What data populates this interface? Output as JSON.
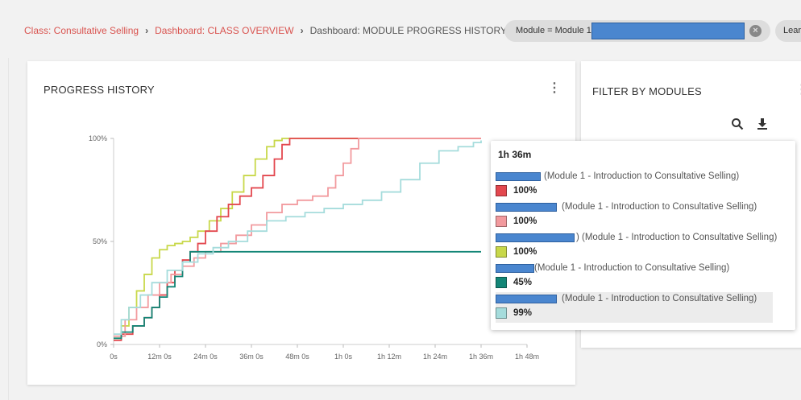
{
  "breadcrumb": {
    "items": [
      "Class: Consultative Selling",
      "Dashboard: CLASS OVERVIEW"
    ],
    "current": "Dashboard: MODULE PROGRESS HISTORY",
    "separator": "›"
  },
  "filter_pill": {
    "label": "Module = Module 1",
    "close_icon": "close-circle-icon"
  },
  "filter_pill_2": {
    "label": "Lear"
  },
  "progress_card": {
    "title": "PROGRESS HISTORY",
    "menu_icon": "kebab-menu-icon"
  },
  "filter_card": {
    "title": "FILTER BY MODULES",
    "menu_icon": "kebab-menu-icon",
    "search_icon": "search-icon",
    "download_icon": "download-icon"
  },
  "tooltip": {
    "time": "1h 36m",
    "rows": [
      {
        "name": "(Module 1 - Introduction to Consultative Selling)",
        "value": "100%",
        "color": "#e3484f"
      },
      {
        "name": "(Module 1 - Introduction to Consultative Selling)",
        "value": "100%",
        "color": "#f29a9e"
      },
      {
        "name": ") (Module 1 - Introduction to Consultative Selling)",
        "value": "100%",
        "color": "#c8d84a"
      },
      {
        "name": "(Module 1 - Introduction to Consultative Selling)",
        "value": "45%",
        "color": "#138677"
      },
      {
        "name": "(Module 1 - Introduction to Consultative Selling)",
        "value": "99%",
        "color": "#a5dcdc"
      }
    ]
  },
  "chart_data": {
    "type": "line",
    "title": "PROGRESS HISTORY",
    "x_unit": "minutes",
    "xlim": [
      0,
      108
    ],
    "ylim": [
      0,
      100
    ],
    "x_ticks": [
      0,
      12,
      24,
      36,
      48,
      60,
      72,
      84,
      96,
      108
    ],
    "x_tick_labels": [
      "0s",
      "12m 0s",
      "24m 0s",
      "36m 0s",
      "48m 0s",
      "1h 0s",
      "1h 12m",
      "1h 24m",
      "1h 36m",
      "1h 48m"
    ],
    "y_ticks": [
      0,
      50,
      100
    ],
    "y_tick_labels": [
      "0%",
      "50%",
      "100%"
    ],
    "grid": false,
    "legend": "none",
    "step": true,
    "series": [
      {
        "color": "#c8d84a",
        "x": [
          0,
          2,
          4,
          6,
          8,
          10,
          12,
          14,
          16,
          18,
          20,
          22,
          25,
          28,
          31,
          34,
          37,
          40,
          42,
          44
        ],
        "y": [
          3,
          9,
          18,
          26,
          34,
          42,
          46,
          48,
          49,
          50,
          52,
          55,
          60,
          66,
          74,
          82,
          90,
          96,
          99,
          100
        ]
      },
      {
        "color": "#e3484f",
        "x": [
          0,
          2,
          5,
          8,
          10,
          12,
          14,
          16,
          18,
          20,
          22,
          24,
          27,
          30,
          33,
          36,
          39,
          42,
          44,
          46
        ],
        "y": [
          2,
          5,
          9,
          13,
          18,
          24,
          30,
          36,
          41,
          45,
          49,
          55,
          62,
          68,
          72,
          76,
          82,
          90,
          97,
          100
        ]
      },
      {
        "color": "#f29a9e",
        "x": [
          0,
          3,
          6,
          9,
          12,
          15,
          18,
          21,
          24,
          28,
          32,
          36,
          40,
          44,
          48,
          52,
          56,
          58,
          60,
          62,
          64
        ],
        "y": [
          4,
          12,
          18,
          24,
          30,
          34,
          38,
          42,
          45,
          49,
          53,
          58,
          64,
          68,
          70,
          72,
          76,
          82,
          88,
          95,
          100
        ]
      },
      {
        "color": "#138677",
        "x": [
          0,
          2,
          5,
          8,
          10,
          12,
          14,
          16,
          18,
          20,
          96
        ],
        "y": [
          3,
          6,
          9,
          13,
          18,
          23,
          28,
          33,
          40,
          45,
          45
        ]
      },
      {
        "color": "#a5dcdc",
        "x": [
          0,
          2,
          4,
          7,
          10,
          14,
          18,
          22,
          26,
          30,
          35,
          40,
          45,
          50,
          55,
          60,
          65,
          70,
          75,
          80,
          85,
          90,
          94,
          96
        ],
        "y": [
          5,
          12,
          18,
          24,
          30,
          36,
          40,
          44,
          47,
          50,
          55,
          60,
          62,
          64,
          66,
          68,
          70,
          74,
          80,
          88,
          94,
          96,
          98,
          99
        ]
      }
    ]
  }
}
